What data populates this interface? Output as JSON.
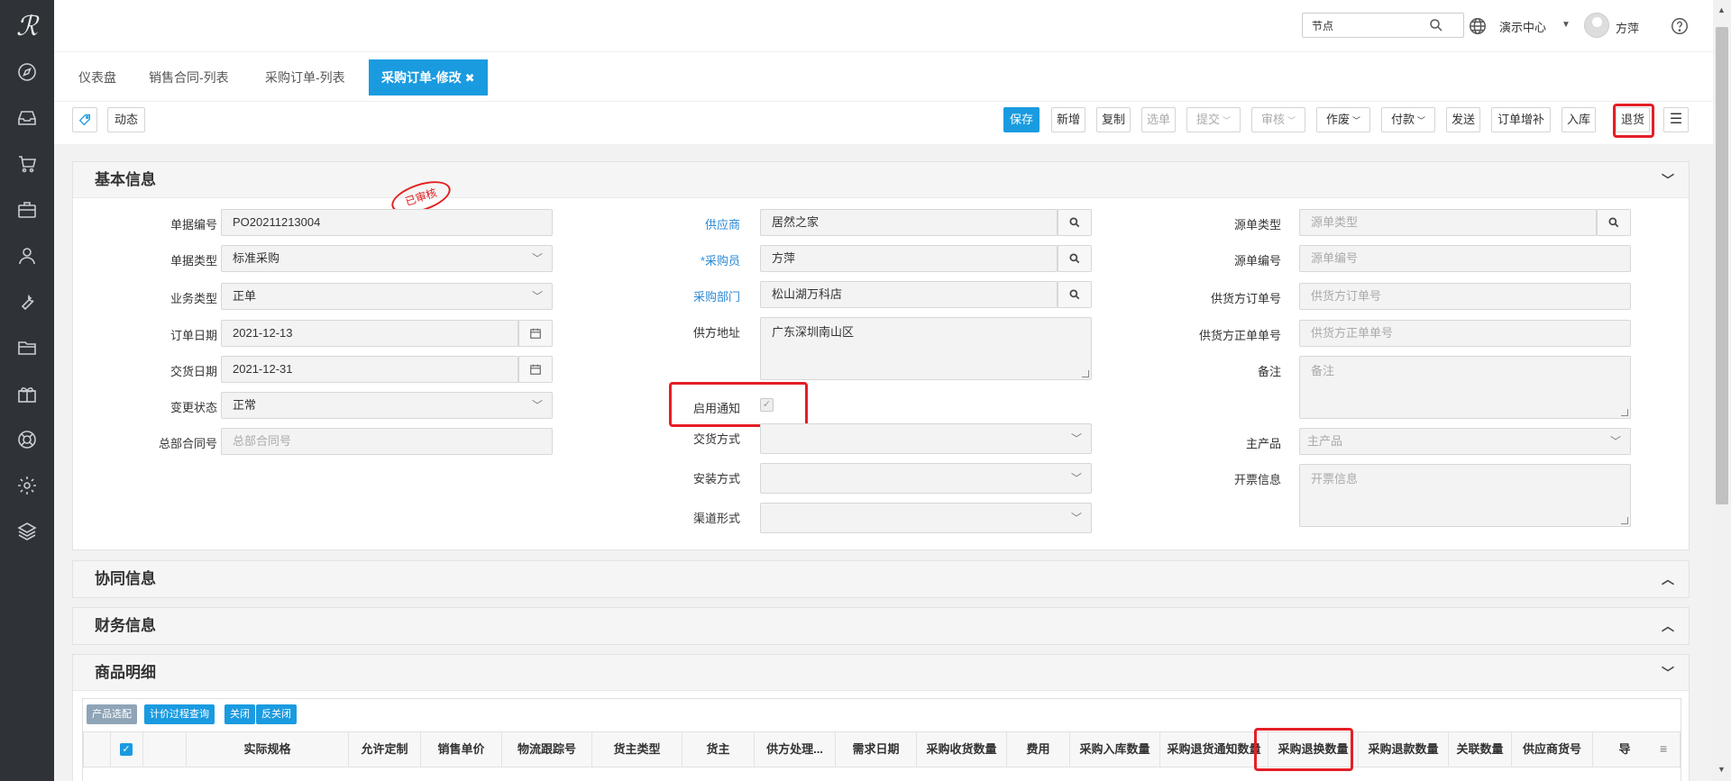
{
  "topbar": {
    "search_value": "节点",
    "center_menu": "演示中心",
    "user_name": "方萍"
  },
  "tabs": [
    "仪表盘",
    "销售合同-列表",
    "采购订单-列表",
    "采购订单-修改"
  ],
  "toolbar": {
    "dynamic_label": "动态",
    "buttons": [
      "保存",
      "新增",
      "复制",
      "选单",
      "提交",
      "审核",
      "作废",
      "付款",
      "发送",
      "订单增补",
      "入库",
      "退货"
    ]
  },
  "panels": {
    "basic": "基本信息",
    "collab": "协同信息",
    "finance": "财务信息",
    "items": "商品明细"
  },
  "stamp": "已审核",
  "form": {
    "doc_no_label": "单据编号",
    "doc_no": "PO20211213004",
    "doc_type_label": "单据类型",
    "doc_type": "标准采购",
    "biz_type_label": "业务类型",
    "biz_type": "正单",
    "order_date_label": "订单日期",
    "order_date": "2021-12-13",
    "delivery_date_label": "交货日期",
    "delivery_date": "2021-12-31",
    "change_status_label": "变更状态",
    "change_status": "正常",
    "master_contract_label": "总部合同号",
    "master_contract_ph": "总部合同号",
    "supplier_label": "供应商",
    "supplier": "居然之家",
    "buyer_label": "*采购员",
    "buyer": "方萍",
    "dept_label": "采购部门",
    "dept": "松山湖万科店",
    "supplier_addr_label": "供方地址",
    "supplier_addr": "广东深圳南山区",
    "notify_label": "启用通知",
    "delivery_method_label": "交货方式",
    "install_method_label": "安装方式",
    "channel_label": "渠道形式",
    "source_type_label": "源单类型",
    "source_type_ph": "源单类型",
    "source_no_label": "源单编号",
    "source_no_ph": "源单编号",
    "supplier_order_label": "供货方订单号",
    "supplier_order_ph": "供货方订单号",
    "supplier_po_label": "供货方正单单号",
    "supplier_po_ph": "供货方正单单号",
    "remark_label": "备注",
    "remark_ph": "备注",
    "main_product_label": "主产品",
    "main_product_ph": "主产品",
    "invoice_label": "开票信息",
    "invoice_ph": "开票信息"
  },
  "grid": {
    "buttons": [
      "产品选配",
      "计价过程查询",
      "关闭",
      "反关闭"
    ],
    "columns": [
      "实际规格",
      "允许定制",
      "销售单价",
      "物流跟踪号",
      "货主类型",
      "货主",
      "供方处理...",
      "需求日期",
      "采购收货数量",
      "费用",
      "采购入库数量",
      "采购退货通知数量",
      "采购退换数量",
      "采购退款数量",
      "关联数量",
      "供应商货号",
      "导"
    ]
  },
  "colors": {
    "primary": "#1a9be0",
    "highlight": "#e41e26",
    "nav_bg": "#2f3338"
  }
}
